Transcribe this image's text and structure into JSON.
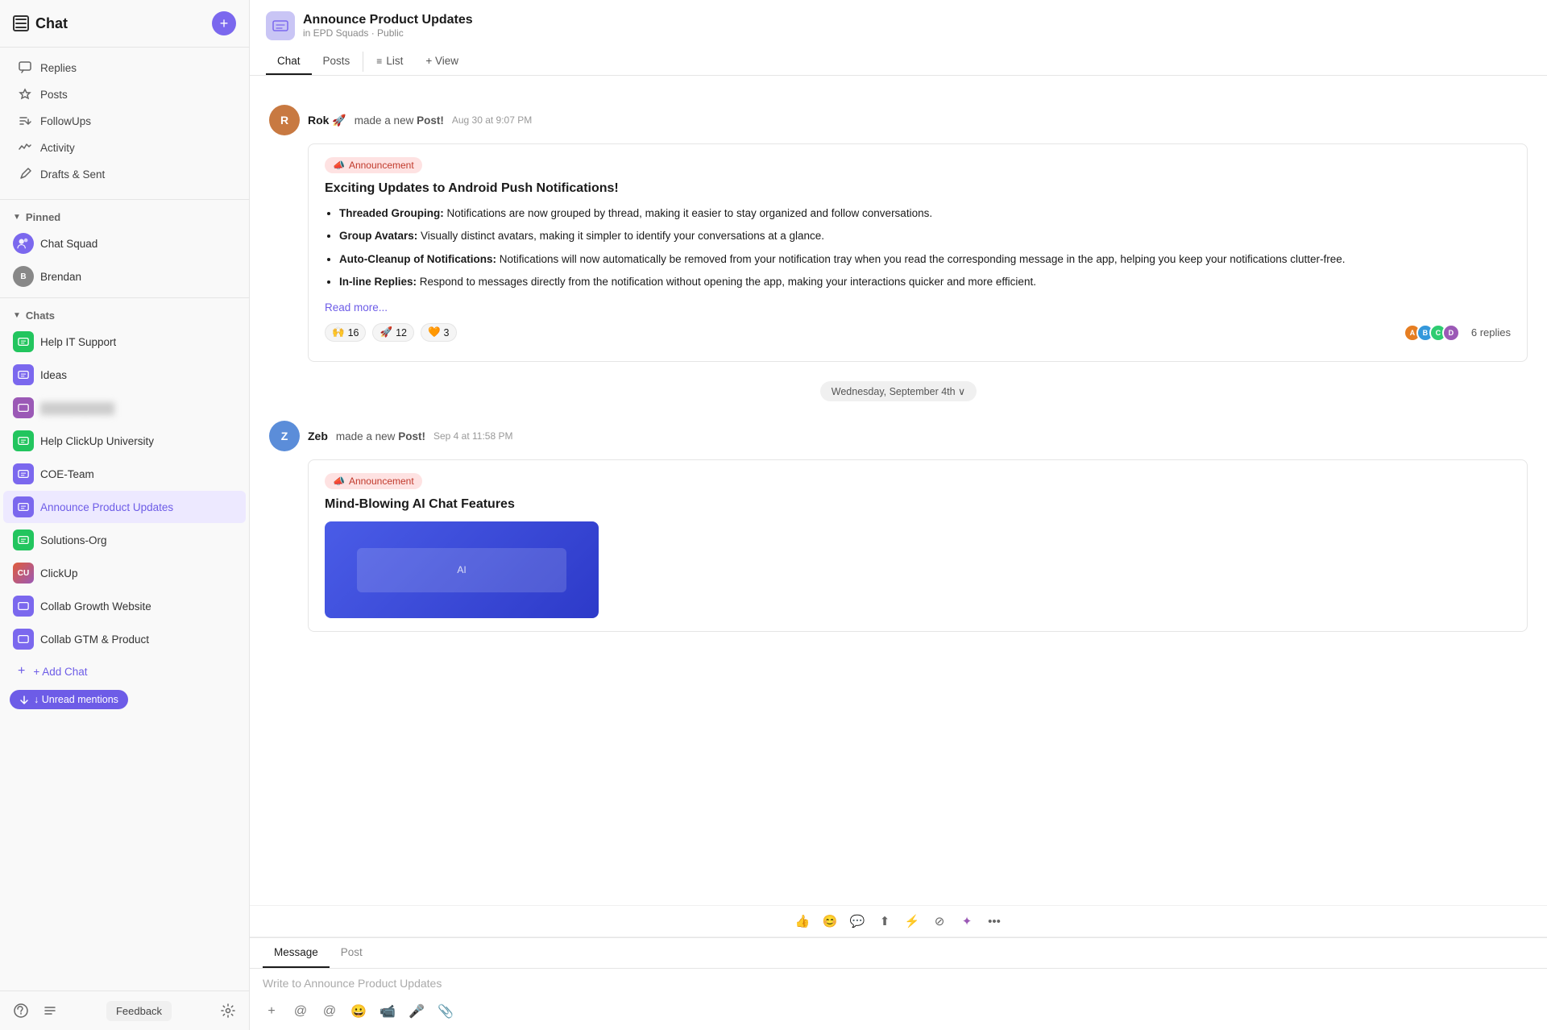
{
  "sidebar": {
    "title": "Chat",
    "add_button": "+",
    "nav_items": [
      {
        "id": "replies",
        "label": "Replies",
        "icon": "💬"
      },
      {
        "id": "posts",
        "label": "Posts",
        "icon": "△"
      },
      {
        "id": "followups",
        "label": "FollowUps",
        "icon": "⟲"
      },
      {
        "id": "activity",
        "label": "Activity",
        "icon": "∿"
      },
      {
        "id": "drafts",
        "label": "Drafts & Sent",
        "icon": "▷"
      }
    ],
    "pinned_section": "Pinned",
    "pinned_items": [
      {
        "id": "chat-squad",
        "label": "Chat Squad",
        "icon": "💬",
        "color": "#7b68ee"
      },
      {
        "id": "brendan",
        "label": "Brendan",
        "color": "#888"
      }
    ],
    "chats_section": "Chats",
    "chat_items": [
      {
        "id": "help-it",
        "label": "Help IT Support",
        "color": "#22c55e"
      },
      {
        "id": "ideas",
        "label": "Ideas",
        "color": "#7b68ee"
      },
      {
        "id": "blurred",
        "label": "██████████",
        "blurred": true,
        "color": "#9b59b6"
      },
      {
        "id": "help-clickup",
        "label": "Help ClickUp University",
        "color": "#22c55e"
      },
      {
        "id": "coe-team",
        "label": "COE-Team",
        "color": "#7b68ee"
      },
      {
        "id": "announce",
        "label": "Announce Product Updates",
        "color": "#7b68ee",
        "active": true
      },
      {
        "id": "solutions-org",
        "label": "Solutions-Org",
        "color": "#22c55e"
      },
      {
        "id": "clickup",
        "label": "ClickUp",
        "color": "#e05c3a"
      },
      {
        "id": "collab-growth",
        "label": "Collab Growth Website",
        "color": "#7b68ee"
      },
      {
        "id": "collab-gtm",
        "label": "Collab GTM & Product",
        "color": "#7b68ee"
      }
    ],
    "add_chat": "+ Add Chat",
    "unread_mentions": "↓ Unread mentions",
    "footer": {
      "feedback": "Feedback"
    }
  },
  "channel": {
    "name": "Announce Product Updates",
    "sub": "in EPD Squads · Public",
    "tabs": [
      "Chat",
      "Posts",
      "List",
      "+ View"
    ]
  },
  "messages": [
    {
      "id": "msg1",
      "author": "Rok 🚀",
      "action": "made a new",
      "action_bold": "Post!",
      "time": "Aug 30 at 9:07 PM",
      "badge": "📣 Announcement",
      "title": "Exciting Updates to Android Push Notifications!",
      "bullets": [
        {
          "bold": "Threaded Grouping:",
          "text": " Notifications are now grouped by thread, making it easier to stay organized and follow conversations."
        },
        {
          "bold": "Group Avatars:",
          "text": " Visually distinct avatars, making it simpler to identify your conversations at a glance."
        },
        {
          "bold": "Auto-Cleanup of Notifications:",
          "text": " Notifications will now automatically be removed from your notification tray when you read the corresponding message in the app, helping you keep your notifications clutter-free."
        },
        {
          "bold": "In-line Replies:",
          "text": " Respond to messages directly from the notification without opening the app, making your interactions quicker and more efficient."
        }
      ],
      "read_more": "Read more...",
      "reactions": [
        {
          "emoji": "🙌",
          "count": "16"
        },
        {
          "emoji": "🚀",
          "count": "12"
        },
        {
          "emoji": "🧡",
          "count": "3"
        }
      ],
      "reply_count": "6 replies"
    },
    {
      "id": "msg2",
      "date_divider": "Wednesday, September 4th ∨",
      "author": "Zeb",
      "action": "made a new",
      "action_bold": "Post!",
      "time": "Sep 4 at 11:58 PM",
      "badge": "📣 Announcement",
      "title": "Mind-Blowing AI Chat Features"
    }
  ],
  "input": {
    "tabs": [
      "Message",
      "Post"
    ],
    "placeholder": "Write to Announce Product Updates",
    "toolbar_icons": [
      "👍",
      "😊",
      "💬",
      "⬆",
      "⚡",
      "⊘",
      "😀",
      "•••"
    ]
  }
}
